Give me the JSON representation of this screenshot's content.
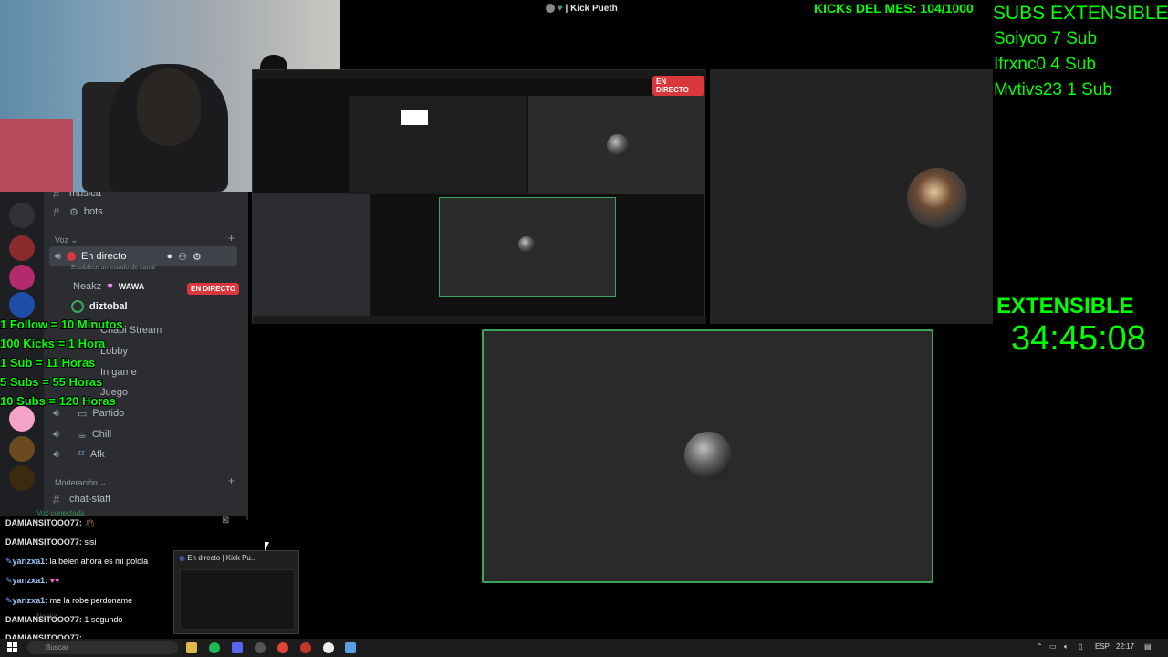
{
  "stream_title": "| Kick Pueth",
  "kicks_counter": "KICKs DEL MES: 104/1000",
  "subs": {
    "title": "SUBS EXTENSIBLE",
    "entries": [
      "Soiyoo 7 Sub",
      "Ifrxnc0 4 Sub",
      "Mvtivs23 1 Sub"
    ]
  },
  "extensible": {
    "label": "EXTENSIBLE",
    "timer": "34:45:08"
  },
  "rules": [
    "1 Follow = 10 Minutos",
    "100 Kicks = 1 Hora",
    "1 Sub = 11 Horas",
    "5 Subs = 55 Horas",
    "10 Subs = 120 Horas"
  ],
  "discord": {
    "channels": {
      "musica": "musica",
      "bots": "bots",
      "voz_category": "Voz",
      "en_directo": "En directo",
      "status_hint": "Establece un estado de canal",
      "user1": "Neakz",
      "user1_tag": "WAWA",
      "user2": "diztobal",
      "chapi": "Chapi Stream",
      "lobby": "Lobby",
      "ingame": "In game",
      "juego": "Juego",
      "partido": "Partido",
      "chill": "Chill",
      "afk": "Afk",
      "moderacion": "Moderación",
      "chat_staff": "chat-staff"
    },
    "live_badge": "EN DIRECTO",
    "voice_connected": "Voz conectada",
    "voice_user": "Neakz"
  },
  "mirror_badge": "EN DIRECTO",
  "chat": [
    {
      "user": "DAMIANSITOOO77:",
      "text": "",
      "blue": false
    },
    {
      "user": "DAMIANSITOOO77:",
      "text": "sisi",
      "blue": false
    },
    {
      "user": "yarizxa1:",
      "text": "la belen ahora es mi polola",
      "blue": true
    },
    {
      "user": "yarizxa1:",
      "text": "",
      "blue": true
    },
    {
      "user": "yarizxa1:",
      "text": "me la robe perdoname",
      "blue": true
    },
    {
      "user": "DAMIANSITOOO77:",
      "text": "1 segundo",
      "blue": false
    },
    {
      "user": "DAMIANSITOOO77:",
      "text": "",
      "blue": false
    }
  ],
  "preview_title": "En directo | Kick Pu...",
  "taskbar": {
    "search_placeholder": "Buscar",
    "lang": "ESP",
    "time": "22:17"
  },
  "colors": {
    "overlay_green": "#00ff00",
    "live_red": "#da373c",
    "speaking_green": "#3ba55d",
    "discord_bg": "#2b2d31"
  }
}
